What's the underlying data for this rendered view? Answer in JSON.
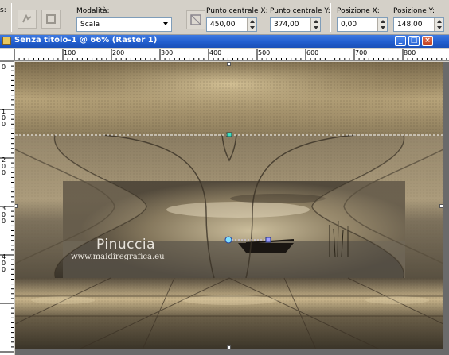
{
  "toolbar": {
    "partial_label": "s:",
    "mode_label": "Modalità:",
    "mode_value": "Scala",
    "center_x_label": "Punto centrale X:",
    "center_x_value": "450,00",
    "center_y_label": "Punto centrale Y:",
    "center_y_value": "374,00",
    "pos_x_label": "Posizione X:",
    "pos_x_value": "0,00",
    "pos_y_label": "Posizione Y:",
    "pos_y_value": "148,00"
  },
  "window": {
    "title": "Senza titolo-1 @ 66% (Raster 1)"
  },
  "ruler": {
    "h_ticks": [
      "100",
      "200",
      "300",
      "400",
      "500",
      "600",
      "700",
      "800"
    ],
    "v_ticks": [
      "0",
      "1\n0\n0",
      "2\n0\n0",
      "3\n0\n0",
      "4\n0\n0"
    ]
  },
  "canvas": {
    "watermark_name": "Pinuccia",
    "watermark_url": "www.maidiregrafica.eu"
  },
  "colors": {
    "title_bar": "#2460d0",
    "canvas_sepia": "#9a8a6a"
  }
}
